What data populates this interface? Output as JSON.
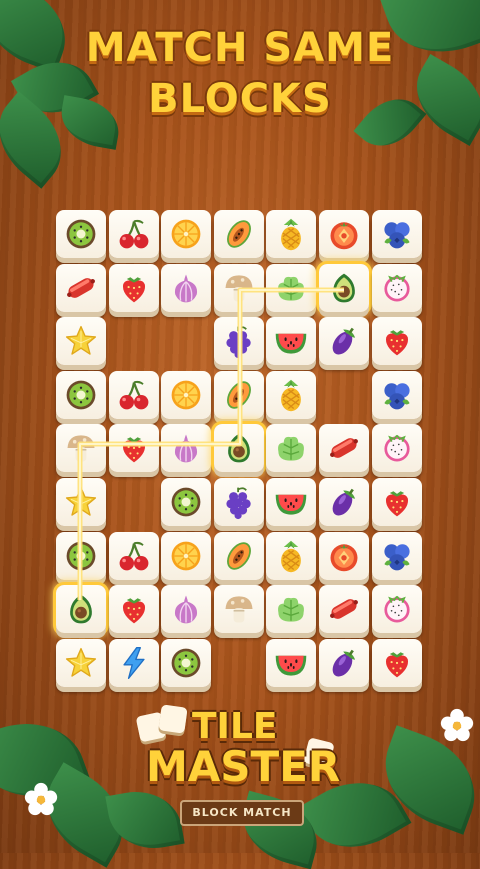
{
  "headline": {
    "line1": "MATCH SAME",
    "line2": "BLOCKS"
  },
  "logo": {
    "line1": "TILE",
    "line2": "MASTER",
    "subtitle": "BLOCK MATCH"
  },
  "colors": {
    "accent": "#ffd23a",
    "highlight": "#ffc93a",
    "wood": "#a8531b",
    "tile": "#fffdf7"
  },
  "board": {
    "rows": [
      [
        "kiwi",
        "cherry",
        "orange",
        "papaya",
        "pineapple",
        "tomato",
        "blueberry"
      ],
      [
        "sausage",
        "strawberry",
        "onion",
        "mushroom",
        "lettuce",
        "avocado",
        "dragonfruit"
      ],
      [
        "starfruit",
        "",
        "",
        "grape",
        "watermelon",
        "eggplant",
        "strawberry"
      ],
      [
        "kiwi",
        "cherry",
        "orange",
        "papaya",
        "pineapple",
        "",
        "blueberry"
      ],
      [
        "mushroom",
        "strawberry",
        "onion",
        "avocado",
        "lettuce",
        "sausage",
        "dragonfruit"
      ],
      [
        "starfruit",
        "",
        "kiwi",
        "grape",
        "watermelon",
        "eggplant",
        "strawberry"
      ],
      [
        "kiwi",
        "cherry",
        "orange",
        "papaya",
        "pineapple",
        "tomato",
        "blueberry"
      ],
      [
        "avocado",
        "strawberry",
        "onion",
        "mushroom",
        "lettuce",
        "sausage",
        "dragonfruit"
      ],
      [
        "starfruit",
        "lightning",
        "kiwi",
        "",
        "watermelon",
        "eggplant",
        "strawberry"
      ]
    ],
    "selected": [
      [
        1,
        5
      ],
      [
        4,
        3
      ],
      [
        7,
        0
      ]
    ]
  }
}
